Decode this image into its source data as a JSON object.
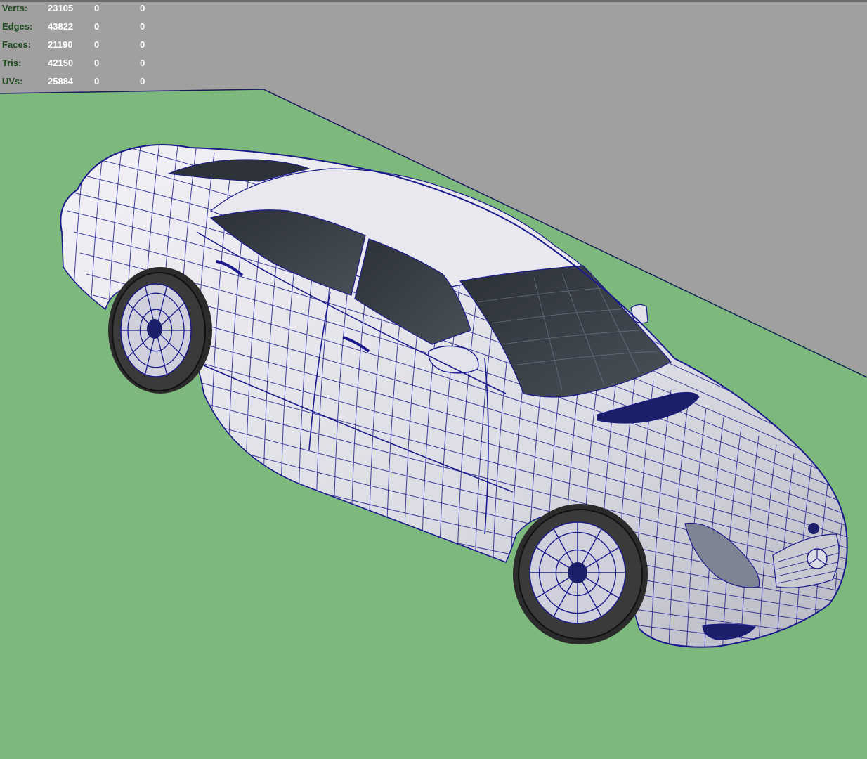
{
  "viewport": {
    "colors": {
      "background": "#a0a0a0",
      "ground_plane": "#7db87d",
      "wireframe": "#1a1a8c",
      "body_shade": "#e4e4ec",
      "glass": "#3a3f47"
    }
  },
  "heads_up_display": {
    "rows": [
      {
        "label": "Verts:",
        "value": "23105",
        "selected": "0",
        "component": "0"
      },
      {
        "label": "Edges:",
        "value": "43822",
        "selected": "0",
        "component": "0"
      },
      {
        "label": "Faces:",
        "value": "21190",
        "selected": "0",
        "component": "0"
      },
      {
        "label": "Tris:",
        "value": "42150",
        "selected": "0",
        "component": "0"
      },
      {
        "label": "UVs:",
        "value": "25884",
        "selected": "0",
        "component": "0"
      }
    ]
  }
}
